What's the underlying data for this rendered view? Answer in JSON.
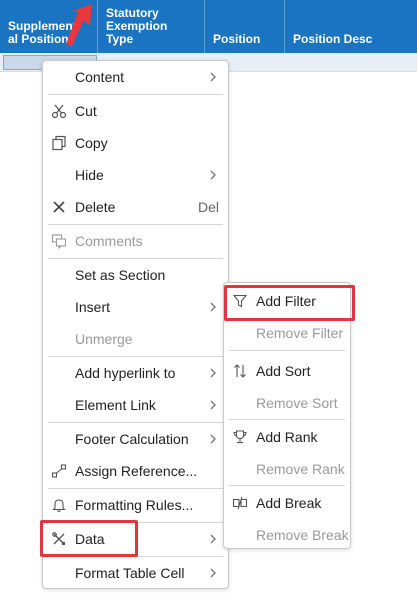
{
  "table": {
    "columns": [
      {
        "label": "Supplement\nal Position"
      },
      {
        "label": "Statutory\nExemption\nType"
      },
      {
        "label": "Position"
      },
      {
        "label": "Position Desc"
      }
    ]
  },
  "context_menu": {
    "items": [
      {
        "label": "Content",
        "submenu": true
      },
      {
        "label": "Cut",
        "icon": "scissors-icon"
      },
      {
        "label": "Copy",
        "icon": "copy-icon"
      },
      {
        "label": "Hide",
        "submenu": true
      },
      {
        "label": "Delete",
        "icon": "close-icon",
        "shortcut": "Del"
      },
      {
        "label": "Comments",
        "icon": "comments-icon",
        "disabled": true
      },
      {
        "label": "Set as Section"
      },
      {
        "label": "Insert",
        "submenu": true
      },
      {
        "label": "Unmerge",
        "disabled": true
      },
      {
        "label": "Add hyperlink to",
        "submenu": true
      },
      {
        "label": "Element Link",
        "submenu": true
      },
      {
        "label": "Footer Calculation",
        "submenu": true
      },
      {
        "label": "Assign Reference...",
        "icon": "assign-reference-icon"
      },
      {
        "label": "Formatting Rules...",
        "icon": "bell-icon"
      },
      {
        "label": "Data",
        "icon": "tools-icon",
        "submenu": true,
        "highlighted": true
      },
      {
        "label": "Format Table Cell",
        "submenu": true
      }
    ]
  },
  "data_submenu": {
    "items": [
      {
        "label": "Add Filter",
        "icon": "filter-icon",
        "highlighted": true
      },
      {
        "label": "Remove Filter",
        "disabled": true
      },
      {
        "label": "Add Sort",
        "icon": "sort-icon"
      },
      {
        "label": "Remove Sort",
        "disabled": true
      },
      {
        "label": "Add Rank",
        "icon": "trophy-icon"
      },
      {
        "label": "Remove Rank",
        "disabled": true
      },
      {
        "label": "Add Break",
        "icon": "break-icon"
      },
      {
        "label": "Remove Break",
        "disabled": true
      }
    ]
  },
  "colors": {
    "header_bg": "#1a74c2",
    "highlight": "#e0363f"
  }
}
